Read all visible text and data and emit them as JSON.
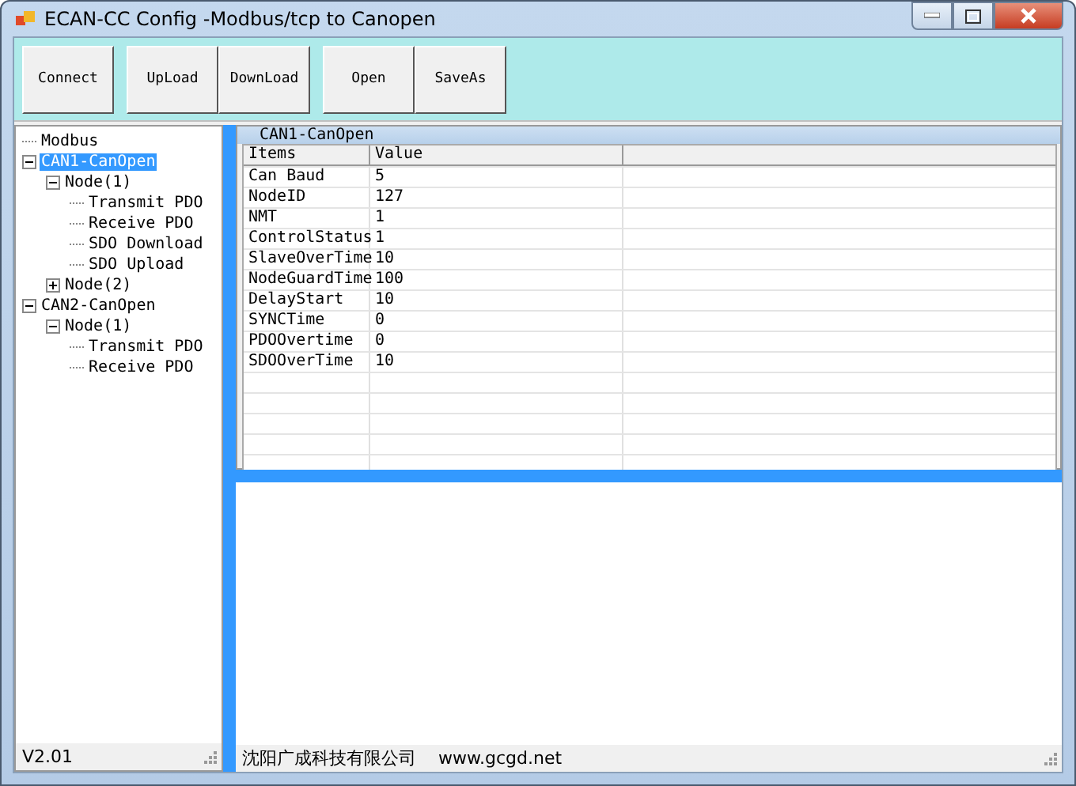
{
  "window": {
    "title": "ECAN-CC Config -Modbus/tcp to Canopen"
  },
  "toolbar": {
    "groups": [
      [
        "Connect"
      ],
      [
        "UpLoad",
        "DownLoad"
      ],
      [
        "Open",
        "SaveAs"
      ]
    ]
  },
  "tree": [
    {
      "label": "Modbus",
      "selected": false
    },
    {
      "label": "CAN1-CanOpen",
      "selected": true,
      "expanded": true,
      "children": [
        {
          "label": "Node(1)",
          "selected": false,
          "expanded": true,
          "children": [
            {
              "label": "Transmit PDO",
              "selected": false
            },
            {
              "label": "Receive PDO",
              "selected": false
            },
            {
              "label": "SDO Download",
              "selected": false
            },
            {
              "label": "SDO Upload",
              "selected": false
            }
          ]
        },
        {
          "label": "Node(2)",
          "selected": false,
          "expanded": false
        }
      ]
    },
    {
      "label": "CAN2-CanOpen",
      "selected": false,
      "expanded": true,
      "children": [
        {
          "label": "Node(1)",
          "selected": false,
          "expanded": true,
          "children": [
            {
              "label": "Transmit PDO",
              "selected": false
            },
            {
              "label": "Receive PDO",
              "selected": false
            }
          ]
        }
      ]
    }
  ],
  "panel": {
    "title": "CAN1-CanOpen",
    "table": {
      "columns": [
        "Items",
        "Value"
      ],
      "rows": [
        [
          "Can Baud",
          "5"
        ],
        [
          "NodeID",
          "127"
        ],
        [
          "NMT",
          "1"
        ],
        [
          "ControlStatus",
          "1"
        ],
        [
          "SlaveOverTime",
          "10"
        ],
        [
          "NodeGuardTime",
          "100"
        ],
        [
          "DelayStart",
          "10"
        ],
        [
          "SYNCTime",
          "0"
        ],
        [
          "PDOOvertime",
          "0"
        ],
        [
          "SDOOverTime",
          "10"
        ]
      ]
    }
  },
  "status_left": "V2.01",
  "status_right": [
    "沈阳广成科技有限公司",
    "www.gcgd.net"
  ]
}
